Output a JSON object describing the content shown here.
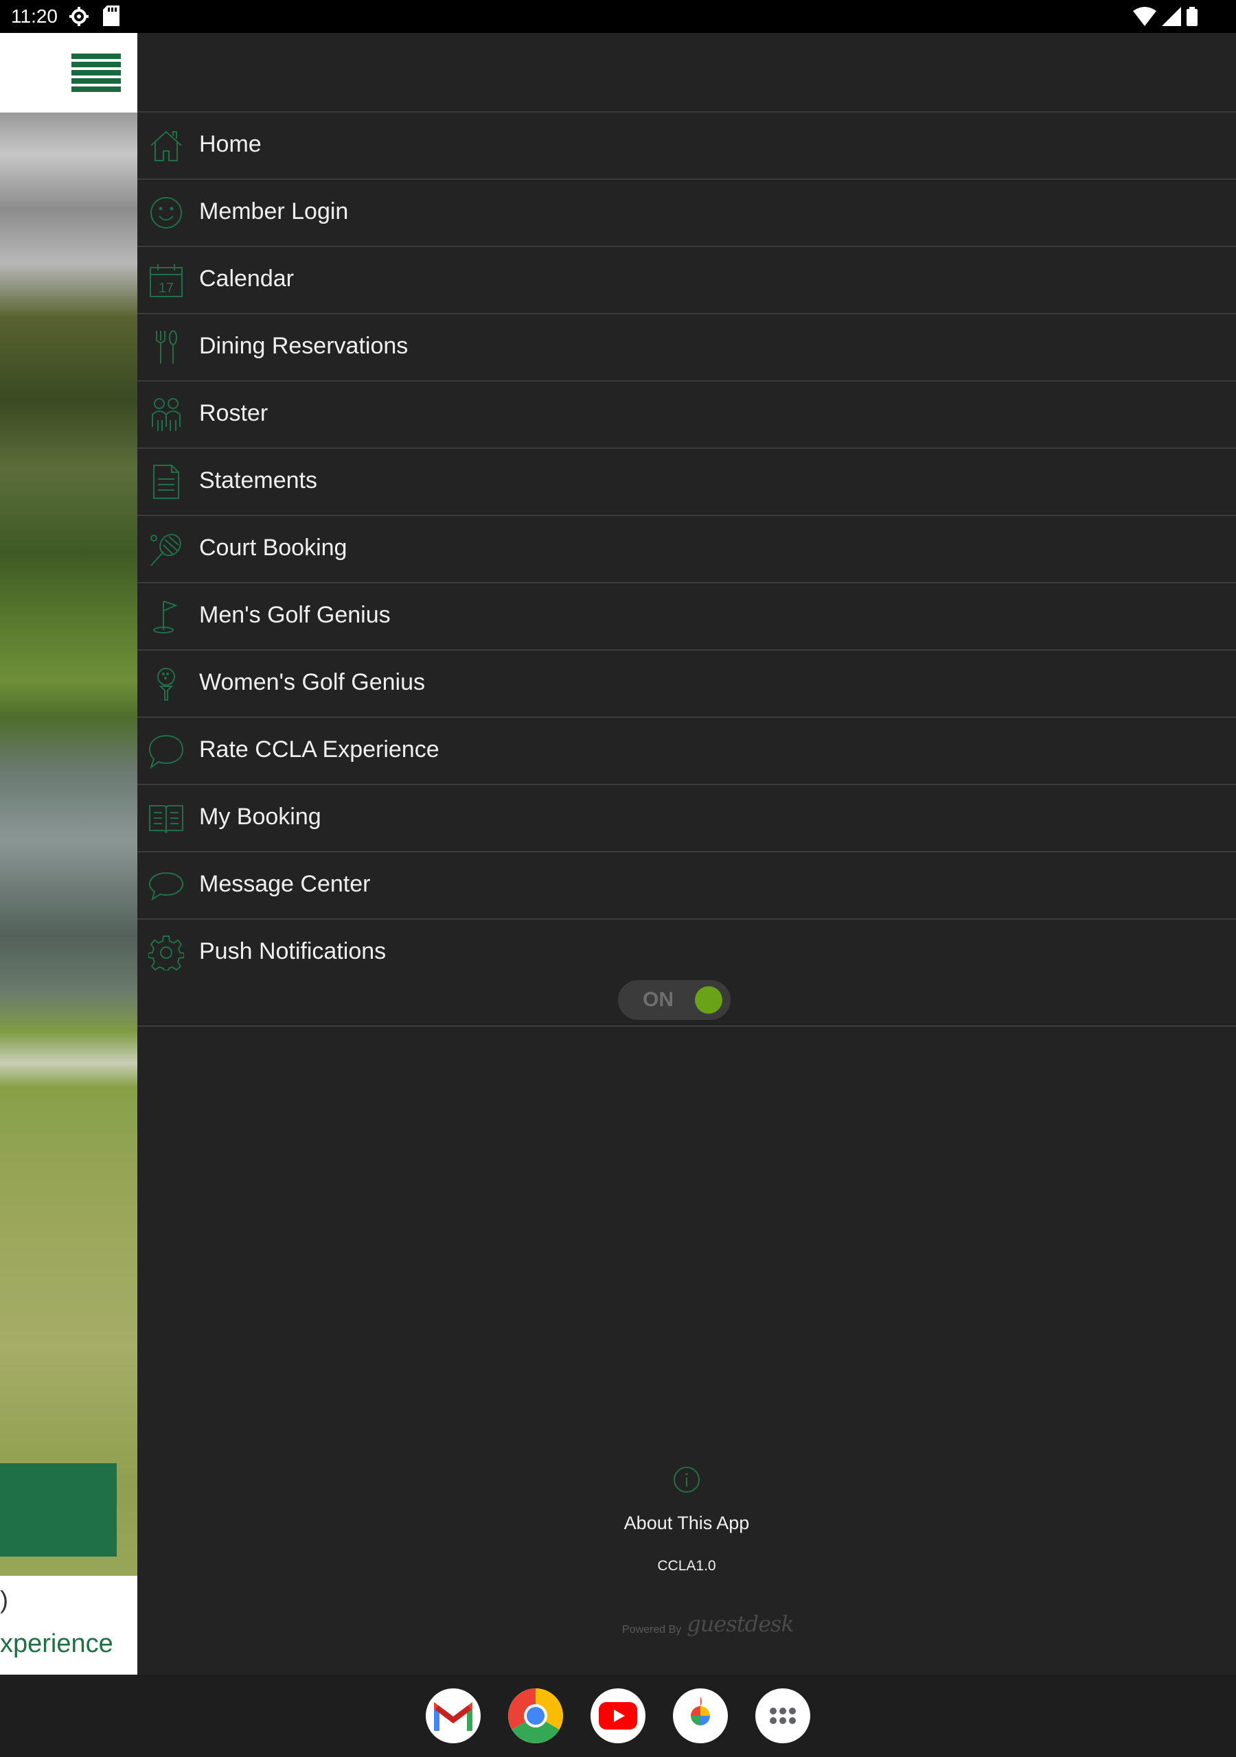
{
  "status_bar": {
    "time": "11:20",
    "icons": [
      "settings-gear-icon",
      "sd-card-icon",
      "wifi-icon",
      "cell-signal-icon",
      "battery-icon"
    ]
  },
  "background_app": {
    "header_icon": "hamburger-menu-icon",
    "partial_text_1": ")",
    "partial_text_2": "xperience",
    "accent_color": "#1f7046"
  },
  "drawer": {
    "menu_items": [
      {
        "label": "Home",
        "icon": "home-icon"
      },
      {
        "label": "Member Login",
        "icon": "smiley-face-icon"
      },
      {
        "label": "Calendar",
        "icon": "calendar-icon",
        "icon_text": "17"
      },
      {
        "label": "Dining Reservations",
        "icon": "fork-knife-icon"
      },
      {
        "label": "Roster",
        "icon": "people-icon"
      },
      {
        "label": "Statements",
        "icon": "document-icon"
      },
      {
        "label": "Court Booking",
        "icon": "tennis-racket-icon"
      },
      {
        "label": "Men's Golf Genius",
        "icon": "golf-flag-icon"
      },
      {
        "label": "Women's Golf Genius",
        "icon": "golf-ball-tee-icon"
      },
      {
        "label": "Rate CCLA Experience",
        "icon": "speech-bubble-icon"
      },
      {
        "label": "My Booking",
        "icon": "open-book-icon"
      },
      {
        "label": "Message Center",
        "icon": "chat-bubble-icon"
      },
      {
        "label": "Push Notifications",
        "icon": "gear-icon"
      }
    ],
    "push_toggle": {
      "state_label": "ON",
      "on": true,
      "knob_color": "#6aa218"
    },
    "footer": {
      "about_icon": "info-icon",
      "about_label": "About This App",
      "version": "CCLA1.0",
      "powered_by_label": "Powered By",
      "powered_by_brand": "guestdesk"
    },
    "icon_color": "#1f7046"
  },
  "dock": {
    "apps": [
      "Gmail",
      "Chrome",
      "YouTube",
      "Photos",
      "App Drawer"
    ]
  }
}
